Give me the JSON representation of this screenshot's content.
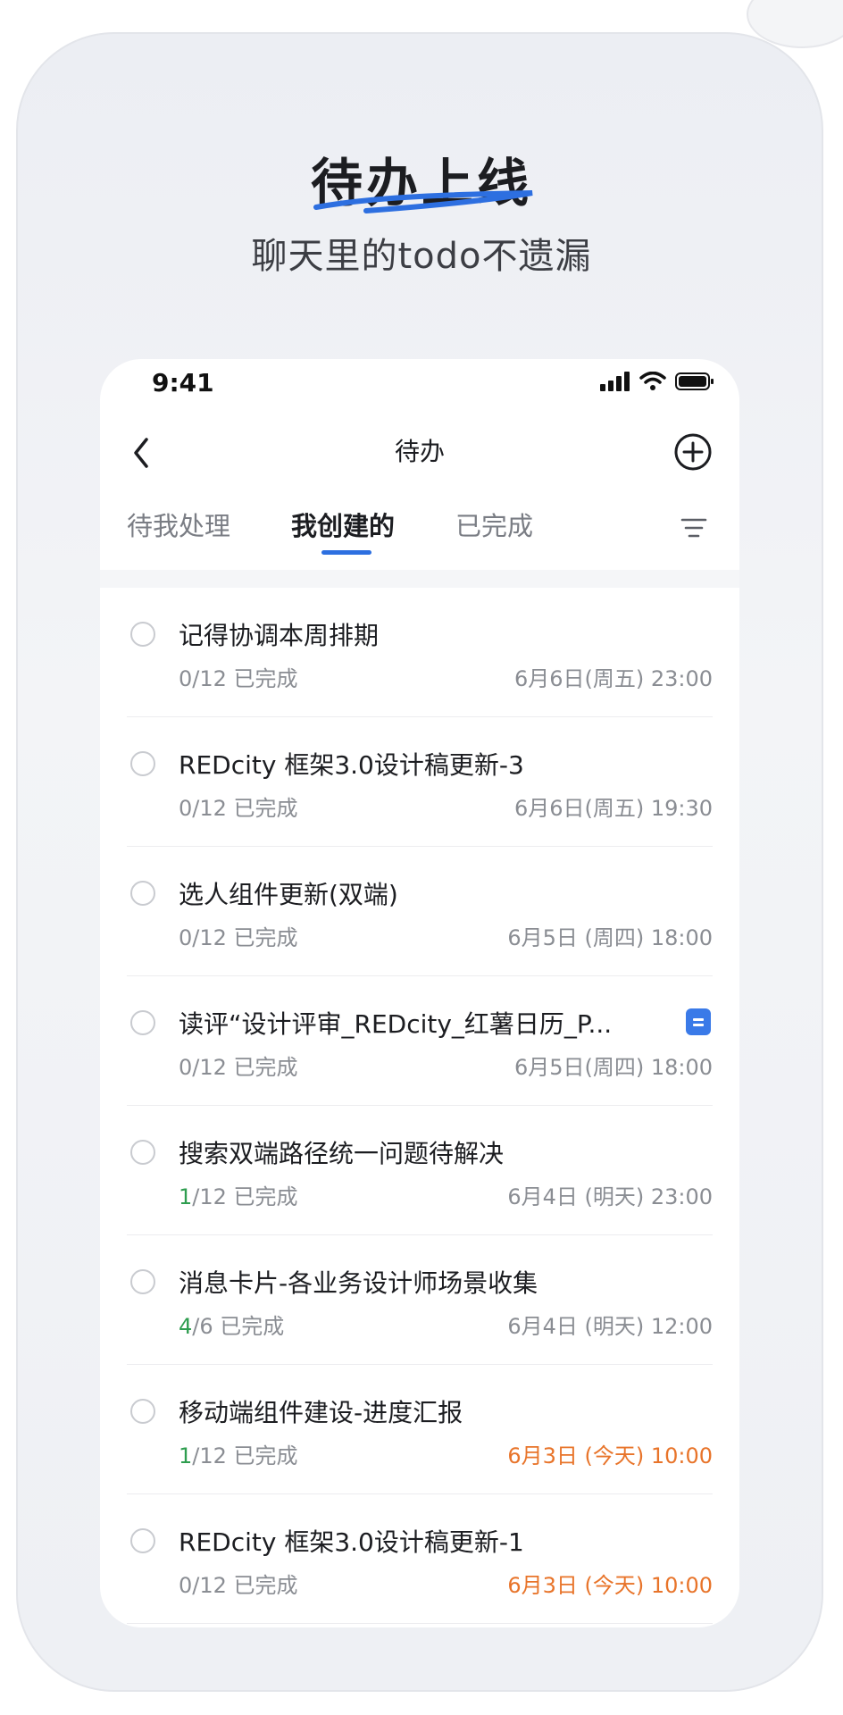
{
  "promo": {
    "headline": "待办上线",
    "subheadline": "聊天里的todo不遗漏",
    "accent_color": "#2d6fe0"
  },
  "status_bar": {
    "time": "9:41",
    "icons": [
      "signal-icon",
      "wifi-icon",
      "battery-icon"
    ]
  },
  "navbar": {
    "title": "待办",
    "back_icon": "chevron-left-icon",
    "add_icon": "plus-circle-icon"
  },
  "tabs": [
    {
      "label": "待我处理",
      "active": false
    },
    {
      "label": "我创建的",
      "active": true
    },
    {
      "label": "已完成",
      "active": false
    }
  ],
  "filter_icon": "filter-icon",
  "todos": [
    {
      "title": "记得协调本周排期",
      "done_count": "0",
      "total": "/12",
      "progress_suffix": " 已完成",
      "due": "6月6日(周五) 23:00",
      "due_status": "normal"
    },
    {
      "title": "REDcity 框架3.0设计稿更新-3",
      "done_count": "0",
      "total": "/12",
      "progress_suffix": " 已完成",
      "due": "6月6日(周五) 19:30",
      "due_status": "normal"
    },
    {
      "title": "选人组件更新(双端)",
      "done_count": "0",
      "total": "/12",
      "progress_suffix": " 已完成",
      "due": "6月5日 (周四) 18:00",
      "due_status": "normal"
    },
    {
      "title": "读评“设计评审_REDcity_红薯日历_P...",
      "done_count": "0",
      "total": "/12",
      "progress_suffix": " 已完成",
      "due": "6月5日(周四) 18:00",
      "due_status": "normal",
      "has_doc": true
    },
    {
      "title": "搜索双端路径统一问题待解决",
      "done_count": "1",
      "total": "/12",
      "progress_suffix": " 已完成",
      "due": "6月4日 (明天) 23:00",
      "due_status": "normal"
    },
    {
      "title": "消息卡片-各业务设计师场景收集",
      "done_count": "4",
      "total": "/6",
      "progress_suffix": " 已完成",
      "due": "6月4日 (明天) 12:00",
      "due_status": "normal"
    },
    {
      "title": "移动端组件建设-进度汇报",
      "done_count": "1",
      "total": "/12",
      "progress_suffix": " 已完成",
      "due": "6月3日 (今天) 10:00",
      "due_status": "today"
    },
    {
      "title": "REDcity 框架3.0设计稿更新-1",
      "done_count": "0",
      "total": "/12",
      "progress_suffix": " 已完成",
      "due": "6月3日 (今天) 10:00",
      "due_status": "today"
    }
  ],
  "colors": {
    "done_green": "#2e9d4f",
    "today_orange": "#e8742a",
    "doc_blue": "#3a7ae8"
  }
}
